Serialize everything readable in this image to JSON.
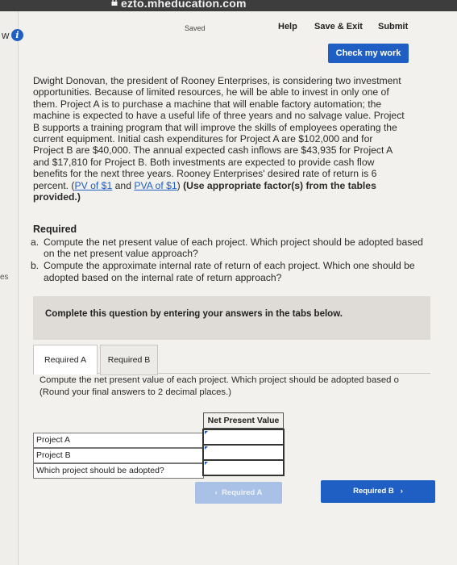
{
  "browser": {
    "url": "ezto.mheducation.com"
  },
  "left_strip": {
    "text_top": "w",
    "text_mid": "es"
  },
  "header": {
    "saved": "Saved",
    "help": "Help",
    "save_exit": "Save & Exit",
    "submit": "Submit",
    "check_work": "Check my work"
  },
  "problem": {
    "lines": [
      "Dwight Donovan, the president of Rooney Enterprises, is considering two investment",
      "opportunities. Because of limited resources, he will be able to invest in only one of",
      "them. Project A is to purchase a machine that will enable factory automation; the",
      "machine is expected to have a useful life of three years and no salvage value. Project",
      "B supports a training program that will improve the skills of employees operating the",
      "current equipment. Initial cash expenditures for Project A are $102,000 and for",
      "Project B are $40,000. The annual expected cash inflows are $43,935 for Project A",
      "and $17,810 for Project B. Both investments are expected to provide cash flow",
      "benefits for the next three years. Rooney Enterprises' desired rate of return is 6"
    ],
    "last_prefix": "percent. (",
    "link1": "PV of $1",
    "and": " and ",
    "link2": "PVA of $1",
    "close": ")",
    "bold1": " (Use appropriate factor(s) from the tables",
    "bold2": "provided.)"
  },
  "required": {
    "heading": "Required",
    "a_marker": "a.",
    "a_text": "Compute the net present value of each project. Which project should be adopted based on the net present value approach?",
    "b_marker": "b.",
    "b_text": "Compute the approximate internal rate of return of each project. Which one should be adopted based on the internal rate of return approach?"
  },
  "complete_text": "Complete this question by entering your answers in the tabs below.",
  "tabs": [
    "Required A",
    "Required B"
  ],
  "instructions": {
    "line1": "Compute the net present value of each project. Which project should be adopted based o",
    "line2": "(Round your final answers to 2 decimal places.)"
  },
  "table": {
    "header": "Net Present Value",
    "rows": [
      {
        "label": "Project A",
        "value": ""
      },
      {
        "label": "Project B",
        "value": ""
      },
      {
        "label": "Which project should be adopted?",
        "value": ""
      }
    ]
  },
  "nav": {
    "prev": "Required A",
    "next": "Required B"
  },
  "colors": {
    "accent": "#1f5fc4",
    "accent_disabled": "#a9c1e6"
  }
}
